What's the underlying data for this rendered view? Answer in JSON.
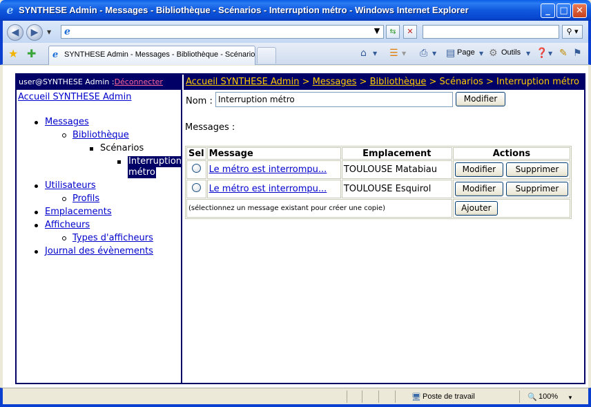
{
  "window": {
    "title": "SYNTHESE Admin - Messages - Bibliothèque - Scénarios - Interruption métro - Windows Internet Explorer",
    "minimize_icon": "minimize-icon",
    "maximize_icon": "maximize-icon",
    "close_icon": "close-icon"
  },
  "addressbar": {
    "url": "",
    "search_value": ""
  },
  "tab": {
    "title": "SYNTHESE Admin - Messages - Bibliothèque - Scénario..."
  },
  "commands": {
    "page": "Page",
    "tools": "Outils"
  },
  "page": {
    "user": "user@SYNTHESE Admin :",
    "logout": "Déconnecter",
    "home_link": "Accueil SYNTHESE Admin",
    "tree": {
      "messages": "Messages",
      "bibliotheque": "Bibliothèque",
      "scenarios": "Scénarios",
      "selected_line1": "Interruption",
      "selected_line2": "métro",
      "utilisateurs": "Utilisateurs",
      "profils": "Profils",
      "emplacements": "Emplacements",
      "afficheurs": "Afficheurs",
      "types_afficheurs": "Types d'afficheurs",
      "journal": "Journal des évènements"
    },
    "breadcrumb": {
      "home": "Accueil SYNTHESE Admin",
      "sep": ">",
      "messages": "Messages",
      "bibliotheque": "Bibliothèque",
      "scenarios": "Scénarios",
      "current": "Interruption métro"
    },
    "form": {
      "nom_label": "Nom :",
      "nom_value": "Interruption métro",
      "modifier_button": "Modifier"
    },
    "messages_label": "Messages :",
    "table": {
      "headers": [
        "Sel",
        "Message",
        "Emplacement",
        "Actions"
      ],
      "rows": [
        {
          "message": "Le métro est interrompu...",
          "emplacement": "TOULOUSE Matabiau",
          "modify": "Modifier",
          "delete": "Supprimer"
        },
        {
          "message": "Le métro est interrompu...",
          "emplacement": "TOULOUSE Esquirol",
          "modify": "Modifier",
          "delete": "Supprimer"
        }
      ],
      "footer_hint": "(sélectionnez un message existant pour créer une copie)",
      "add_button": "Ajouter"
    }
  },
  "statusbar": {
    "zone": "Poste de travail",
    "zoom": "100%"
  }
}
